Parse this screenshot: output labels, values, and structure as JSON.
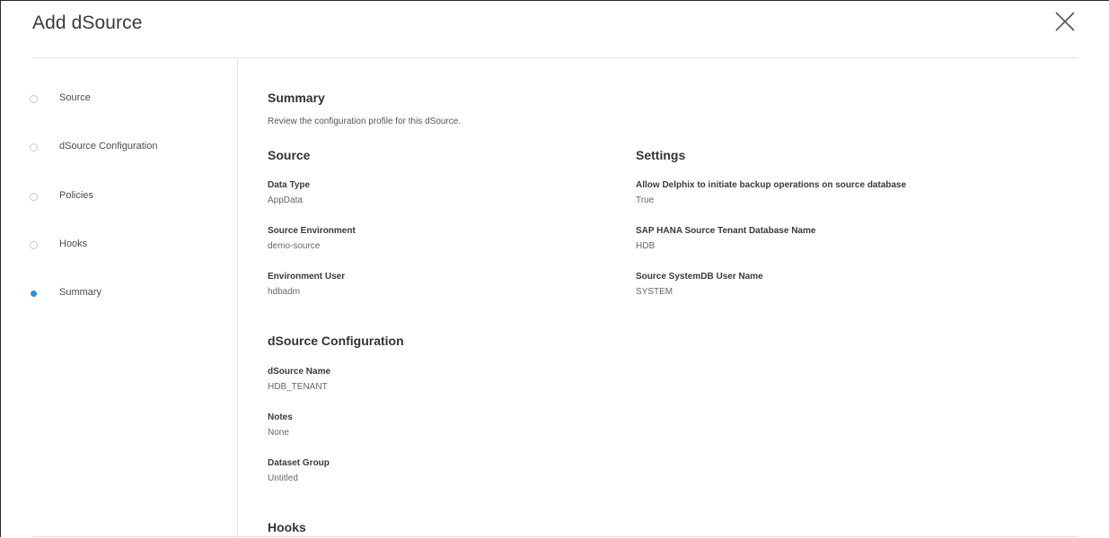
{
  "dialog": {
    "title": "Add dSource",
    "close_icon": "close-icon"
  },
  "steps": [
    {
      "label": "Source",
      "active": false
    },
    {
      "label": "dSource Configuration",
      "active": false
    },
    {
      "label": "Policies",
      "active": false
    },
    {
      "label": "Hooks",
      "active": false
    },
    {
      "label": "Summary",
      "active": true
    }
  ],
  "summary": {
    "heading": "Summary",
    "subtitle": "Review the configuration profile for this dSource.",
    "source": {
      "heading": "Source",
      "fields": [
        {
          "label": "Data Type",
          "value": "AppData"
        },
        {
          "label": "Source Environment",
          "value": "demo-source"
        },
        {
          "label": "Environment User",
          "value": "hdbadm"
        }
      ]
    },
    "settings": {
      "heading": "Settings",
      "fields": [
        {
          "label": "Allow Delphix to initiate backup operations on source database",
          "value": "True"
        },
        {
          "label": "SAP HANA Source Tenant Database Name",
          "value": "HDB"
        },
        {
          "label": "Source SystemDB User Name",
          "value": "SYSTEM"
        }
      ]
    },
    "dsource_config": {
      "heading": "dSource Configuration",
      "fields": [
        {
          "label": "dSource Name",
          "value": "HDB_TENANT"
        },
        {
          "label": "Notes",
          "value": "None"
        },
        {
          "label": "Dataset Group",
          "value": "Untitled"
        }
      ]
    },
    "hooks": {
      "heading": "Hooks"
    }
  },
  "colors": {
    "accent": "#2f8fd8",
    "divider": "#e0e0e0"
  }
}
